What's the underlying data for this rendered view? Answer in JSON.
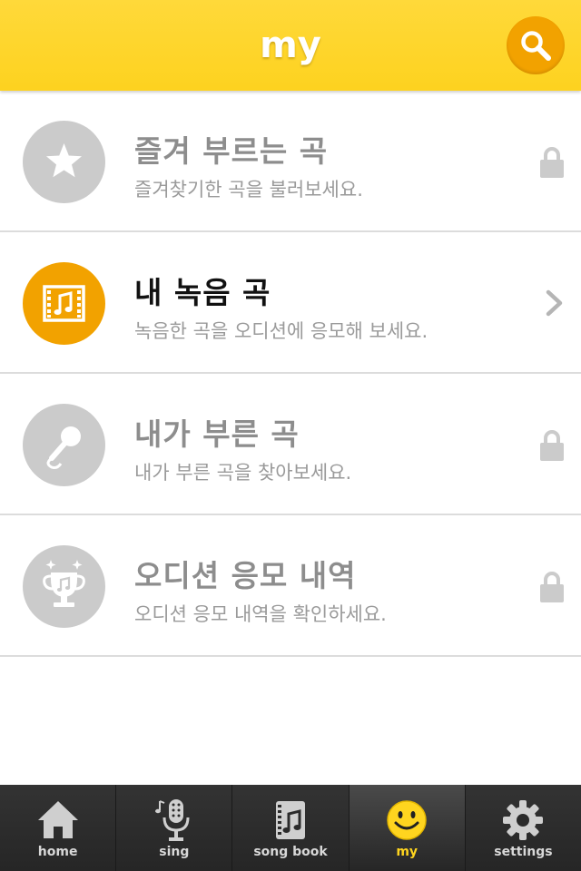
{
  "header": {
    "title": "my"
  },
  "search": {
    "icon": "search-icon",
    "color": "#f2a200"
  },
  "rows": [
    {
      "title": "즐겨 부르는 곡",
      "subtitle": "즐겨찾기한 곡을 불러보세요.",
      "icon": "star-icon",
      "trailing": "lock-icon",
      "active": false
    },
    {
      "title": "내 녹음 곡",
      "subtitle": "녹음한 곡을 오디션에 응모해 보세요.",
      "icon": "film-music-icon",
      "trailing": "chevron-right-icon",
      "active": true
    },
    {
      "title": "내가 부른 곡",
      "subtitle": "내가 부른 곡을 찾아보세요.",
      "icon": "microphone-icon",
      "trailing": "lock-icon",
      "active": false
    },
    {
      "title": "오디션 응모 내역",
      "subtitle": "오디션 응모 내역을 확인하세요.",
      "icon": "trophy-icon",
      "trailing": "lock-icon",
      "active": false
    }
  ],
  "tabs": [
    {
      "label": "home",
      "icon": "home-icon"
    },
    {
      "label": "sing",
      "icon": "microphone-icon"
    },
    {
      "label": "song book",
      "icon": "songbook-icon"
    },
    {
      "label": "my",
      "icon": "smiley-icon",
      "selected": true
    },
    {
      "label": "settings",
      "icon": "gear-icon"
    }
  ],
  "colors": {
    "header": "#fdd21f",
    "accent": "#f2a200",
    "inactive_icon": "#cbcbcb",
    "tabbar": "#2b2b2b",
    "tab_active_label": "#ffd51f"
  }
}
